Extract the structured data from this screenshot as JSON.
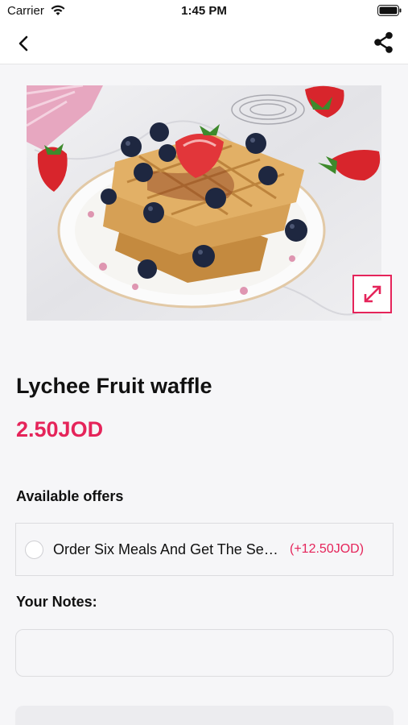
{
  "status_bar": {
    "carrier": "Carrier",
    "time": "1:45 PM"
  },
  "nav": {
    "back_icon": "chevron-left-icon",
    "share_icon": "share-icon"
  },
  "product": {
    "image_alt": "waffle with berries",
    "name": "Lychee Fruit waffle",
    "price": "2.50JOD"
  },
  "offers": {
    "heading": "Available offers",
    "items": [
      {
        "label": "Order Six Meals And Get The Seventh Free",
        "price": "(+12.50JOD)"
      }
    ]
  },
  "notes": {
    "heading": "Your Notes:",
    "placeholder": ""
  },
  "colors": {
    "accent": "#e5245a",
    "background": "#f6f6f8"
  }
}
